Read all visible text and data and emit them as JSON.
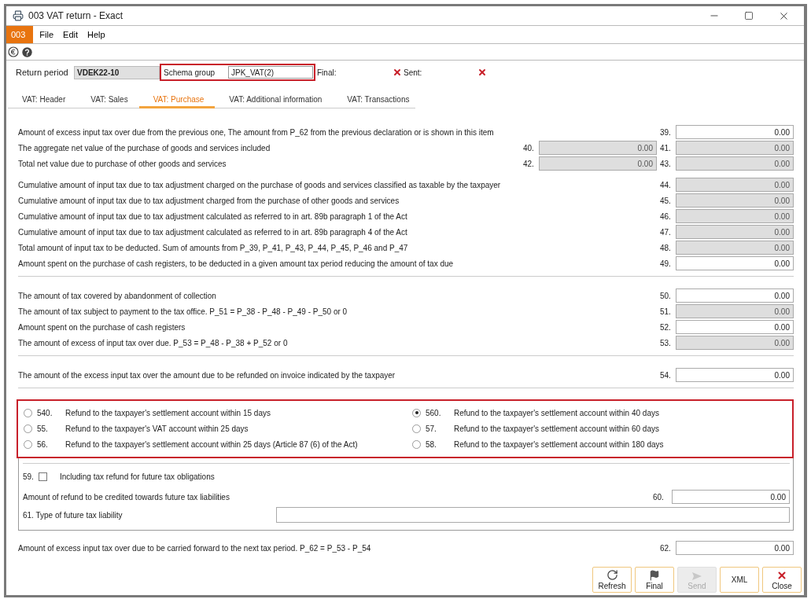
{
  "window": {
    "title": "003 VAT return - Exact"
  },
  "menu": {
    "badge": "003",
    "items": [
      "File",
      "Edit",
      "Help"
    ]
  },
  "header": {
    "return_period": {
      "label": "Return period",
      "value": "VDEK22-10",
      "disabled": true
    },
    "schema_group": {
      "label": "Schema group",
      "value": "JPK_VAT(2)",
      "highlighted": true
    },
    "flags": [
      {
        "label": "Final:",
        "checked": false
      },
      {
        "label": "Sent:",
        "checked": false
      }
    ]
  },
  "tabs": [
    {
      "label": "VAT: Header",
      "selected": false
    },
    {
      "label": "VAT: Sales",
      "selected": false
    },
    {
      "label": "VAT: Purchase",
      "selected": true
    },
    {
      "label": "VAT: Additional information",
      "selected": false
    },
    {
      "label": "VAT: Transactions",
      "selected": false
    }
  ],
  "sections": [
    {
      "groups": [
        [
          {
            "label": "Amount of excess input tax over due from the previous one, The amount from P_62 from the previous declaration or is shown in this item",
            "number": "39.",
            "value": "0.00",
            "disabled": false
          },
          {
            "label": "The aggregate net value of the purchase of goods and services included",
            "left": {
              "number": "40.",
              "value": "0.00",
              "disabled": true
            },
            "number": "41.",
            "value": "0.00",
            "disabled": true
          },
          {
            "label": "Total net value due to purchase of other goods and services",
            "left": {
              "number": "42.",
              "value": "0.00",
              "disabled": true
            },
            "number": "43.",
            "value": "0.00",
            "disabled": true
          }
        ],
        [
          {
            "label": "Cumulative amount of input tax due to tax adjustment charged on the purchase of goods and services classified as taxable by the taxpayer",
            "number": "44.",
            "value": "0.00",
            "disabled": true
          },
          {
            "label": "Cumulative amount of input tax due to tax adjustment charged from the purchase of other goods and services",
            "number": "45.",
            "value": "0.00",
            "disabled": true
          },
          {
            "label": "Cumulative amount of input tax due to tax adjustment calculated as referred to in art. 89b paragraph 1 of the Act",
            "number": "46.",
            "value": "0.00",
            "disabled": true
          },
          {
            "label": "Cumulative amount of input tax due to tax adjustment calculated as referred to in art. 89b paragraph 4 of the Act",
            "number": "47.",
            "value": "0.00",
            "disabled": true
          },
          {
            "label": "Total amount of input tax to be deducted. Sum of amounts from P_39, P_41, P_43, P_44, P_45, P_46 and P_47",
            "number": "48.",
            "value": "0.00",
            "disabled": true
          },
          {
            "label": "Amount spent on the purchase of cash registers, to be deducted in a given amount tax period reducing the amount of tax due",
            "number": "49.",
            "value": "0.00",
            "disabled": false
          }
        ]
      ]
    },
    {
      "groups": [
        [
          {
            "label": "The amount of tax covered by abandonment of collection",
            "number": "50.",
            "value": "0.00",
            "disabled": false
          },
          {
            "label": "The amount of tax subject to payment to the tax office. P_51 = P_38 - P_48 - P_49 - P_50 or 0",
            "number": "51.",
            "value": "0.00",
            "disabled": true
          },
          {
            "label": "Amount spent on the purchase of cash registers",
            "number": "52.",
            "value": "0.00",
            "disabled": false
          },
          {
            "label": "The amount of excess of input tax over due. P_53 = P_48 - P_38 + P_52 or 0",
            "number": "53.",
            "value": "0.00",
            "disabled": true
          }
        ]
      ]
    },
    {
      "groups": [
        [
          {
            "label": "The amount of the excess input tax over the amount due to be refunded on invoice indicated by the taxpayer",
            "number": "54.",
            "value": "0.00",
            "disabled": false
          }
        ]
      ]
    }
  ],
  "refund_options": {
    "highlighted": true,
    "columns": [
      [
        {
          "number": "540.",
          "label": "Refund to the taxpayer's settlement account within 15 days",
          "selected": false
        },
        {
          "number": "55.",
          "label": "Refund to the taxpayer's VAT account within 25 days",
          "selected": false
        },
        {
          "number": "56.",
          "label": "Refund to the taxpayer's settlement account within 25 days (Article 87 (6) of the Act)",
          "selected": false
        }
      ],
      [
        {
          "number": "560.",
          "label": "Refund to the taxpayer's settlement account within 40 days",
          "selected": true
        },
        {
          "number": "57.",
          "label": "Refund to the taxpayer's settlement account within 60 days",
          "selected": false
        },
        {
          "number": "58.",
          "label": "Refund to the taxpayer's settlement account within 180 days",
          "selected": false
        }
      ]
    ]
  },
  "future": {
    "checkbox": {
      "number": "59.",
      "label": "Including tax refund for future tax obligations",
      "checked": false
    },
    "amount": {
      "label": "Amount of refund to be credited towards future tax liabilities",
      "number": "60.",
      "value": "0.00",
      "disabled": false
    },
    "type": {
      "label": "61. Type of future tax liability"
    }
  },
  "carry_forward": {
    "label": "Amount of excess input tax over due to be carried forward to the next tax period. P_62 = P_53 - P_54",
    "number": "62.",
    "value": "0.00",
    "disabled": false
  },
  "buttons": [
    {
      "kind": "refresh",
      "label": "Refresh",
      "disabled": false
    },
    {
      "kind": "final",
      "label": "Final",
      "disabled": false
    },
    {
      "kind": "send",
      "label": "Send",
      "disabled": true
    },
    {
      "kind": "xml",
      "label": "XML",
      "disabled": false
    },
    {
      "kind": "close",
      "label": "Close",
      "disabled": false
    }
  ]
}
